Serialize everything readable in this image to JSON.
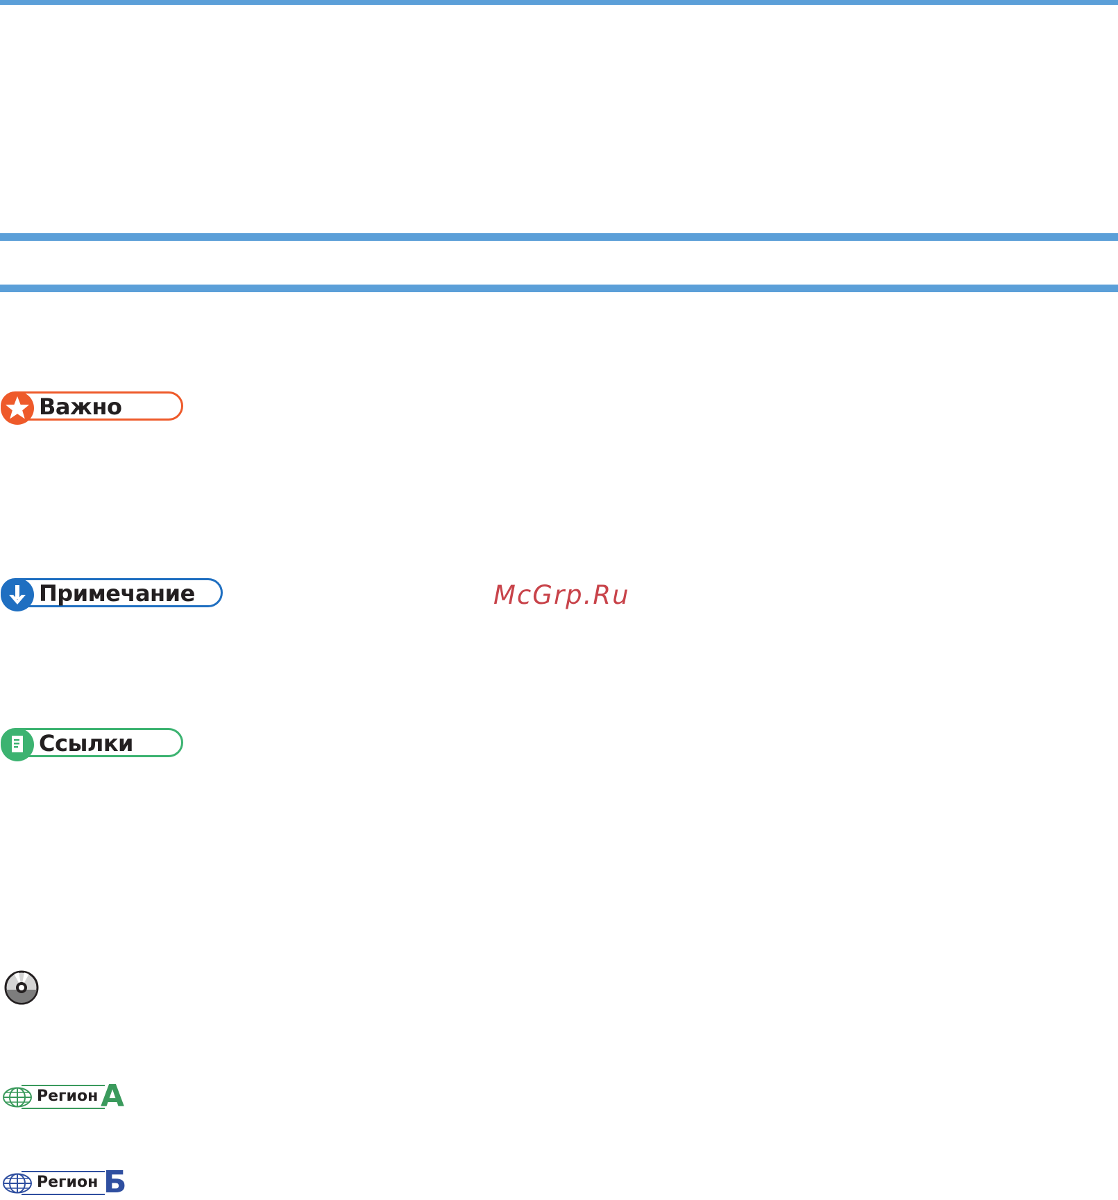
{
  "colors": {
    "rule": "#5b9fd8",
    "important": "#ee5a2a",
    "note": "#1f6fc1",
    "references": "#3cb371",
    "region_a": "#3a9a5c",
    "region_b": "#2f4fa0",
    "watermark": "#c8434a"
  },
  "badges": {
    "important": {
      "label": "Важно",
      "icon": "star-icon"
    },
    "note": {
      "label": "Примечание",
      "icon": "arrow-down-icon"
    },
    "references": {
      "label": "Ссылки",
      "icon": "document-icon"
    }
  },
  "watermark": "McGrp.Ru",
  "disc_icon": "cd-disc-icon",
  "regions": {
    "a": {
      "label": "Регион",
      "letter": "A",
      "icon": "globe-icon"
    },
    "b": {
      "label": "Регион",
      "letter": "Б",
      "icon": "globe-icon"
    }
  }
}
